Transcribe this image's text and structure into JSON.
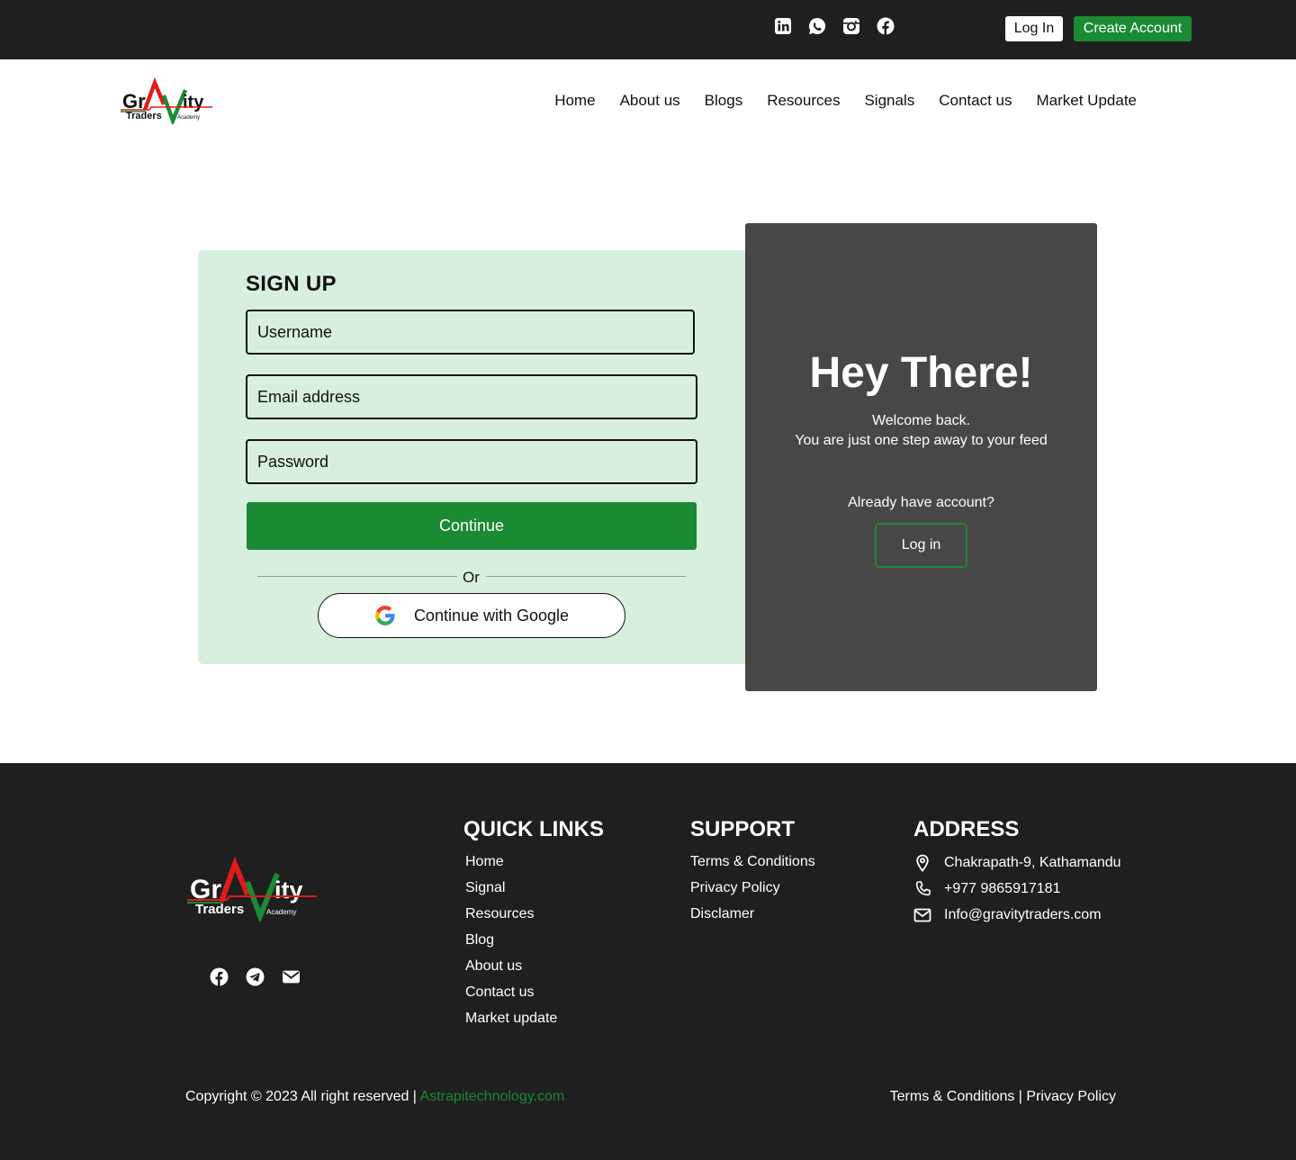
{
  "topbar": {
    "login_label": "Log In",
    "create_label": "Create Account",
    "social_icons": [
      "linkedin-icon",
      "whatsapp-icon",
      "instagram-icon",
      "facebook-icon"
    ]
  },
  "header": {
    "logo_text": {
      "main_a": "Gr",
      "main_b": "ity",
      "sub": "Traders",
      "sub2": "Academy"
    },
    "nav": [
      "Home",
      "About us",
      "Blogs",
      "Resources",
      "Signals",
      "Contact us",
      "Market Update"
    ]
  },
  "signup": {
    "title": "SIGN UP",
    "username_placeholder": "Username",
    "email_placeholder": "Email address",
    "password_placeholder": "Password",
    "continue_label": "Continue",
    "or_label": "Or",
    "google_label": "Continue with Google"
  },
  "welcome": {
    "heading": "Hey There!",
    "line1": "Welcome back.",
    "line2": "You are just one step away to your feed",
    "have_account": "Already have account?",
    "login_label": "Log in"
  },
  "footer": {
    "social_icons": [
      "facebook-icon",
      "telegram-icon",
      "mail-icon"
    ],
    "quick_links_title": "QUICK LINKS",
    "quick_links": [
      "Home",
      "Signal",
      "Resources",
      "Blog",
      "About us",
      "Contact us",
      "Market update"
    ],
    "support_title": "SUPPORT",
    "support_links": [
      "Terms & Conditions",
      "Privacy Policy",
      "Disclamer"
    ],
    "address_title": "ADDRESS",
    "address": "Chakrapath-9, Kathamandu",
    "phone": "+977 9865917181",
    "email": "Info@gravitytraders.com",
    "copyright": "Copyright © 2023 All right reserved | ",
    "copyright_link": "Astrapitechnology.com",
    "terms": "Terms & Conditions |",
    "privacy": "Privacy Policy"
  },
  "colors": {
    "brand_green": "#1a8a33",
    "dark": "#1f1f1f",
    "panel": "#474747",
    "card": "#d6f0dd",
    "logo_red": "#e01b1b"
  }
}
